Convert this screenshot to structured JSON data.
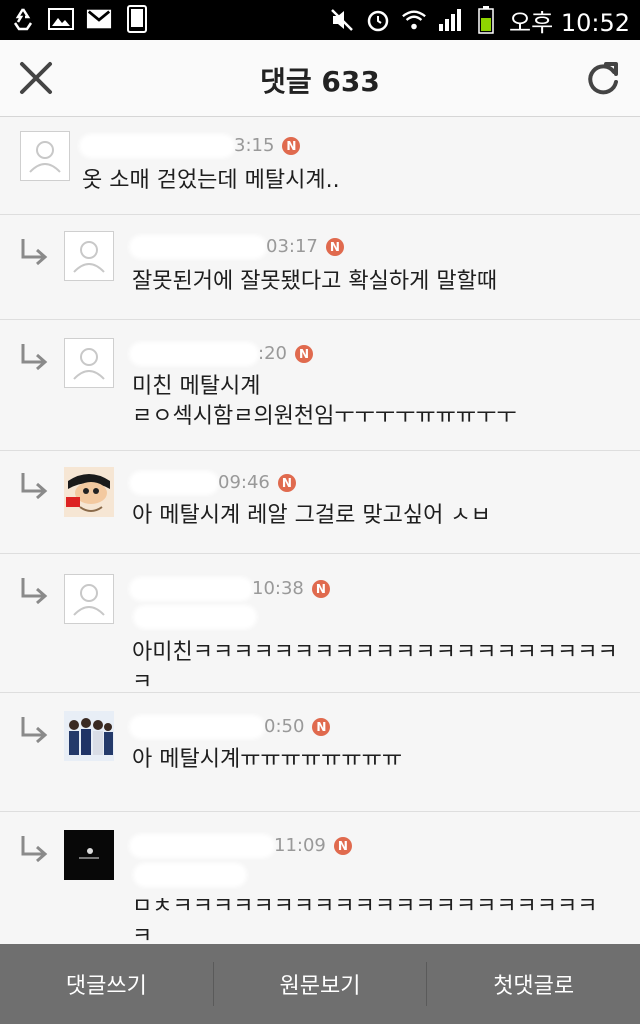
{
  "status_bar": {
    "time": "오후 10:52"
  },
  "header": {
    "title": "댓글 633"
  },
  "comments": [
    {
      "time": "3:15",
      "badge": "N",
      "text": "옷 소매 걷었는데 메탈시계..",
      "avatar": "default-avatar"
    },
    {
      "time": "03:17",
      "badge": "N",
      "text": "잘못된거에 잘못됐다고 확실하게 말할때",
      "avatar": "default-avatar"
    },
    {
      "time": ":20",
      "badge": "N",
      "text": "미친 메탈시계\nㄹㅇ섹시함ㄹ의원천임ㅜㅜㅜㅜㅠㅠㅠㅜㅜ",
      "avatar": "default-avatar"
    },
    {
      "time": "09:46",
      "badge": "N",
      "text": "아 메탈시계 레알 그걸로 맞고싶어 ㅅㅂ",
      "avatar": "cartoon-avatar"
    },
    {
      "time": "10:38",
      "badge": "N",
      "text": "아미친ㅋㅋㅋㅋㅋㅋㅋㅋㅋㅋㅋㅋㅋㅋㅋㅋㅋㅋㅋㅋㅋ\nㅋ",
      "avatar": "default-avatar"
    },
    {
      "time": "0:50",
      "badge": "N",
      "text": "아 메탈시계ㅠㅠㅠㅠㅠㅠㅠㅠ",
      "avatar": "group-photo-avatar"
    },
    {
      "time": "11:09",
      "badge": "N",
      "text": "ㅁㅊㅋㅋㅋㅋㅋㅋㅋㅋㅋㅋㅋㅋㅋㅋㅋㅋㅋㅋㅋㅋㅋ\nㅋ",
      "avatar": "dark-avatar"
    }
  ],
  "bottom_bar": {
    "write_comment": "댓글쓰기",
    "view_original": "원문보기",
    "first_comment": "첫댓글로"
  },
  "colors": {
    "badge": "#e06a4e",
    "bottom_bar": "#6f6f6f",
    "header_bg": "#fafafa"
  }
}
